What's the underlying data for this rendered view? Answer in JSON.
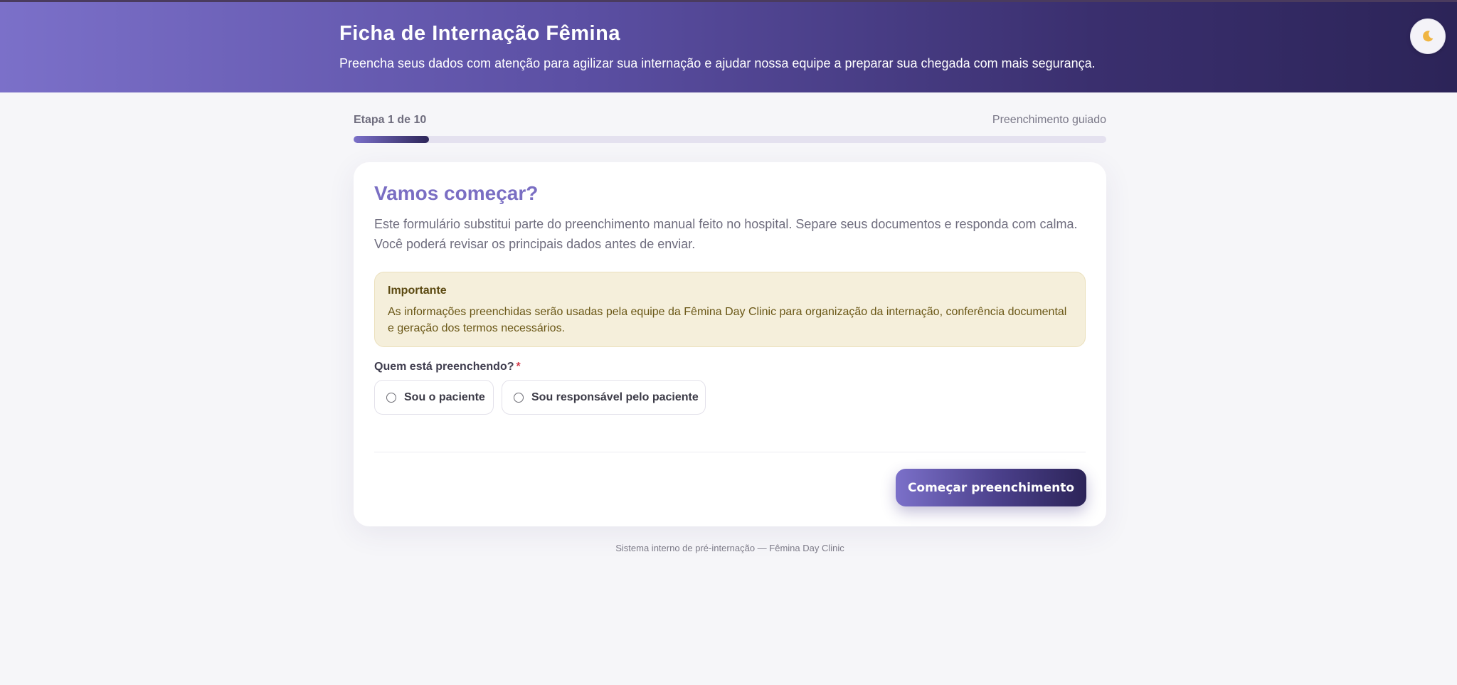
{
  "header": {
    "title": "Ficha de Internação Fêmina",
    "subtitle": "Preencha seus dados com atenção para agilizar sua internação e ajudar nossa equipe a preparar sua chegada com mais segurança.",
    "theme_toggle_icon": "moon-icon"
  },
  "progress": {
    "step_label": "Etapa 1 de 10",
    "mode_label": "Preenchimento guiado",
    "current_step": 1,
    "total_steps": 10,
    "fraction": 0.1
  },
  "card": {
    "title": "Vamos começar?",
    "description": "Este formulário substitui parte do preenchimento manual feito no hospital. Separe seus documentos e responda com calma. Você poderá revisar os principais dados antes de enviar.",
    "notice": {
      "title": "Importante",
      "body": "As informações preenchidas serão usadas pela equipe da Fêmina Day Clinic para organização da internação, conferência documental e geração dos termos necessários."
    },
    "question": {
      "label": "Quem está preenchendo?",
      "required_mark": "*",
      "options": [
        {
          "label": "Sou o paciente",
          "selected": false
        },
        {
          "label": "Sou responsável pelo paciente",
          "selected": false
        }
      ]
    },
    "start_button_label": "Começar preenchimento"
  },
  "footer": {
    "text": "Sistema interno de pré-internação — Fêmina Day Clinic"
  },
  "colors": {
    "accent": "#7a6ec3",
    "header_gradient_start": "#7b70c9",
    "header_gradient_end": "#2c2458",
    "notice_background": "#f5efdb",
    "required": "#d33a4a"
  }
}
